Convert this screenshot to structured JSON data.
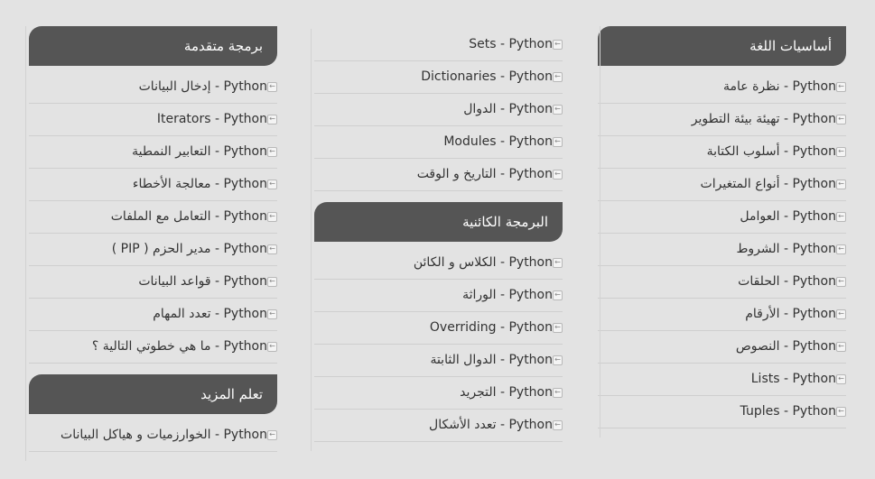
{
  "right": {
    "header": "أساسيات اللغة",
    "items": [
      "Python - نظرة عامة",
      "Python - تهيئة بيئة التطوير",
      "Python - أسلوب الكتابة",
      "Python - أنواع المتغيرات",
      "Python - العوامل",
      "Python - الشروط",
      "Python - الحلقات",
      "Python - الأرقام",
      "Python - النصوص",
      "Lists - Python",
      "Tuples - Python"
    ]
  },
  "middle": {
    "items_top": [
      "Sets - Python",
      "Dictionaries - Python",
      "Python - الدوال",
      "Modules - Python",
      "Python - التاريخ و الوقت"
    ],
    "header": "البرمجة الكائنية",
    "items": [
      "Python - الكلاس و الكائن",
      "Python - الوراثة",
      "Overriding - Python",
      "Python - الدوال الثابتة",
      "Python - التجريد",
      "Python - تعدد الأشكال"
    ]
  },
  "left": {
    "header": "برمجة متقدمة",
    "items": [
      "Python - إدخال البيانات",
      "Iterators - Python",
      "Python - التعابير النمطية",
      "Python - معالجة الأخطاء",
      "Python - التعامل مع الملفات",
      "Python - مدير الحزم ( PIP )",
      "Python - قواعد البيانات",
      "Python - تعدد المهام",
      "Python - ما هي خطوتي التالية ؟"
    ],
    "header2": "تعلم المزيد",
    "items2": [
      "Python - الخوارزميات و هياكل البيانات"
    ]
  },
  "icons": {
    "bullet": "arrow-left-icon"
  }
}
